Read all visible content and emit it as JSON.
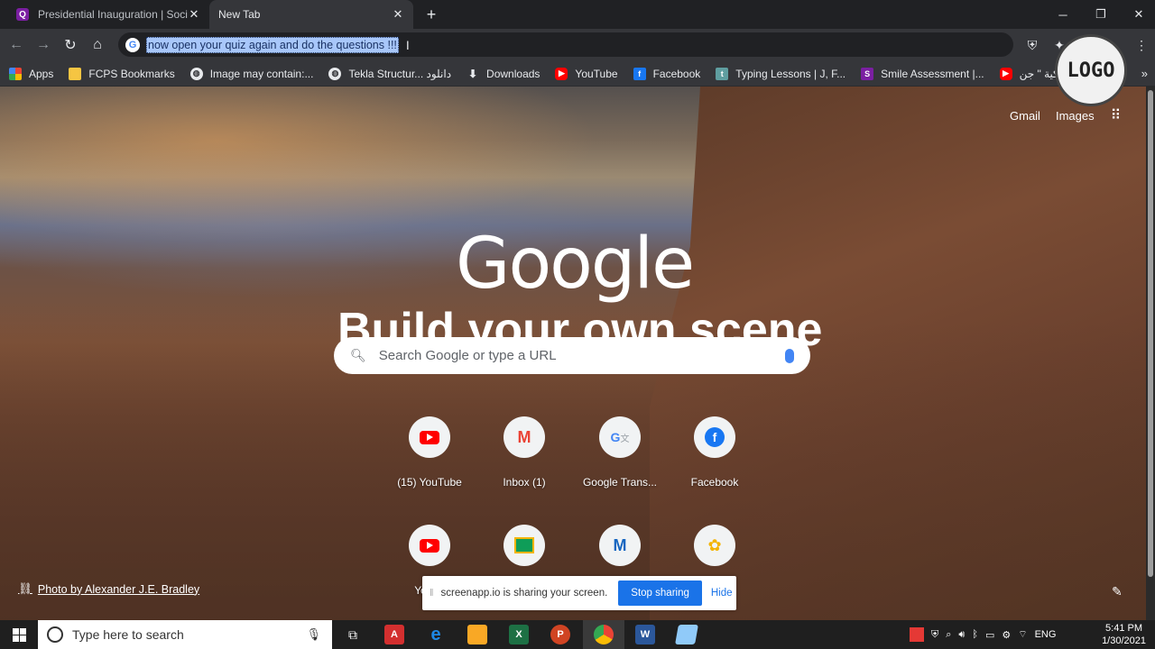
{
  "browser": {
    "tabs": [
      {
        "label": "Presidential Inauguration | Social",
        "active": false
      },
      {
        "label": "New Tab",
        "active": true
      }
    ],
    "omnibox_text": "now open your quiz again and do the questions !!!",
    "bookmarks": [
      {
        "label": "Apps",
        "icon": "apps-grid-icon"
      },
      {
        "label": "FCPS Bookmarks",
        "icon": "folder-icon"
      },
      {
        "label": "Image may contain:...",
        "icon": "globe-icon"
      },
      {
        "label": "Tekla Structur... دانلود",
        "icon": "globe-icon"
      },
      {
        "label": "Downloads",
        "icon": "download-icon"
      },
      {
        "label": "YouTube",
        "icon": "youtube-icon"
      },
      {
        "label": "Facebook",
        "icon": "facebook-icon"
      },
      {
        "label": "Typing Lessons | J, F...",
        "icon": "typing-icon"
      },
      {
        "label": "Smile Assessment |...",
        "icon": "smile-s-icon"
      },
      {
        "label": "القناة الأمريكية \" جن...",
        "icon": "youtube-icon"
      }
    ]
  },
  "overlay_logo": "LOGO",
  "newtab": {
    "top_links": [
      "Gmail",
      "Images"
    ],
    "google_logo": "Google",
    "scene_text": "Build your own scene",
    "search_placeholder": "Search Google or type a URL",
    "shortcuts_row1": [
      {
        "label": "(15) YouTube",
        "icon": "youtube-icon"
      },
      {
        "label": "Inbox (1)",
        "icon": "gmail-icon"
      },
      {
        "label": "Google Trans...",
        "icon": "google-translate-icon"
      },
      {
        "label": "Facebook",
        "icon": "facebook-icon"
      }
    ],
    "shortcuts_row2": [
      {
        "label": "Yo",
        "icon": "youtube-icon"
      },
      {
        "label": "",
        "icon": "classroom-icon"
      },
      {
        "label": "",
        "icon": "m-logo-icon"
      },
      {
        "label": "",
        "icon": "puzzle-icon"
      }
    ],
    "photo_credit": "Photo by Alexander J.E. Bradley"
  },
  "sharing_bar": {
    "message": "screenapp.io is sharing your screen.",
    "stop_label": "Stop sharing",
    "hide_label": "Hide"
  },
  "taskbar": {
    "search_placeholder": "Type here to search",
    "language": "ENG",
    "time": "5:41 PM",
    "date": "1/30/2021"
  },
  "colors": {
    "accent": "#1a73e8",
    "youtube": "#ff0000",
    "facebook": "#1877f2"
  }
}
